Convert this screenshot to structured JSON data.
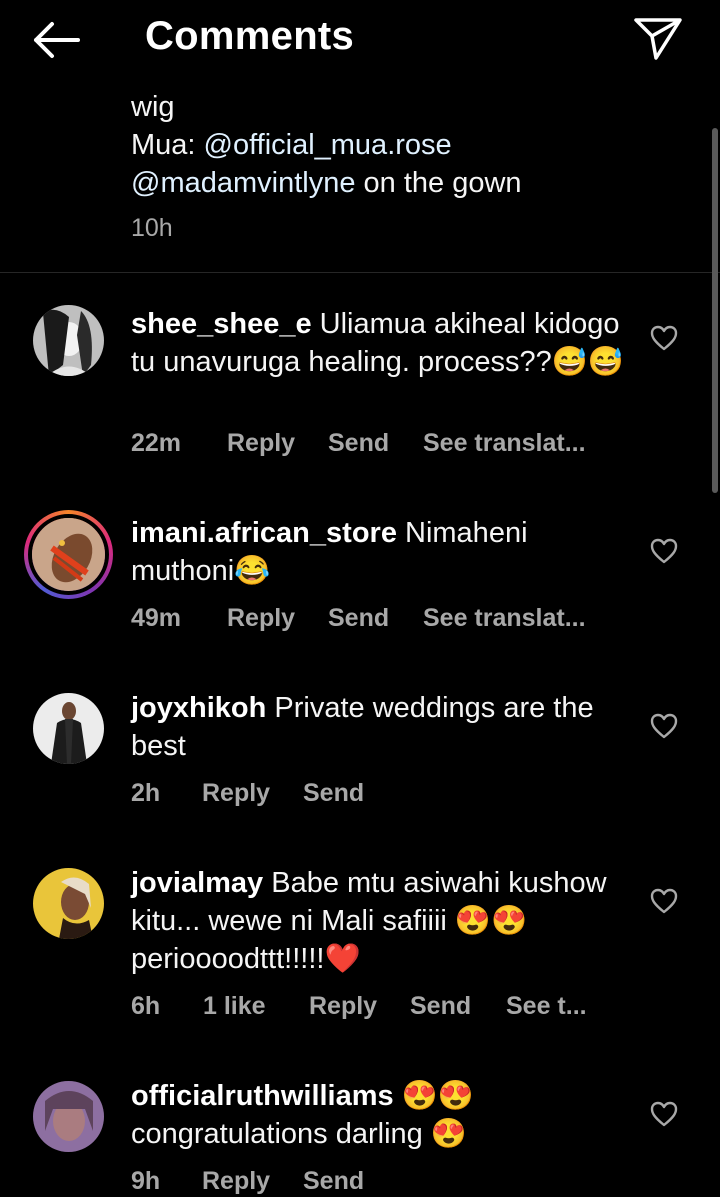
{
  "header": {
    "title": "Comments"
  },
  "caption": {
    "line1": "wig",
    "line2_prefix": "Mua: ",
    "line2_mention": "@official_mua.rose",
    "line3_mention": "@madamvintlyne",
    "line3_suffix": " on the gown",
    "time": "10h"
  },
  "comments": [
    {
      "username": "shee_shee_e",
      "text": "Uliamua akiheal kidogo tu unavuruga healing. process??😅😅",
      "time": "22m",
      "reply": "Reply",
      "send": "Send",
      "translate": "See translat..."
    },
    {
      "username": "imani.african_store",
      "text": "Nimaheni muthoni😂",
      "time": "49m",
      "reply": "Reply",
      "send": "Send",
      "translate": "See translat..."
    },
    {
      "username": "joyxhikoh",
      "text": "Private weddings are the best",
      "time": "2h",
      "reply": "Reply",
      "send": "Send"
    },
    {
      "username": "jovialmay",
      "text": "Babe mtu asiwahi kushow kitu... wewe ni Mali safiiii 😍😍 perioooodttt!!!!!❤️",
      "time": "6h",
      "likes": "1 like",
      "reply": "Reply",
      "send": "Send",
      "translate": "See t..."
    },
    {
      "username": "officialruthwilliams",
      "text": "😍😍 congratulations darling 😍",
      "time": "9h",
      "reply": "Reply",
      "send": "Send"
    }
  ]
}
